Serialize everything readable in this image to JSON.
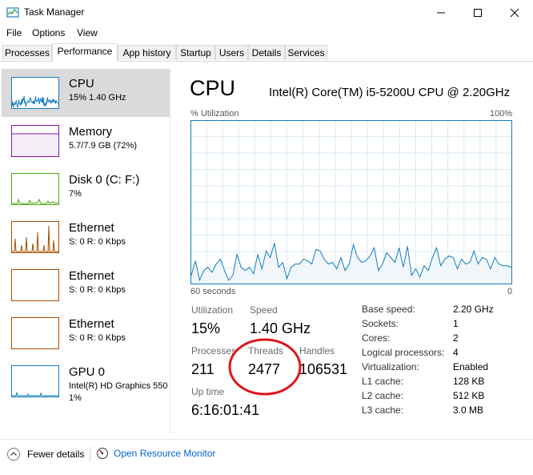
{
  "window": {
    "title": "Task Manager",
    "controls": {
      "minimize": "—",
      "maximize": "☐",
      "close": "✕"
    }
  },
  "menu": [
    "File",
    "Options",
    "View"
  ],
  "tabs": [
    {
      "label": "Processes",
      "active": false
    },
    {
      "label": "Performance",
      "active": true
    },
    {
      "label": "App history",
      "active": false
    },
    {
      "label": "Startup",
      "active": false
    },
    {
      "label": "Users",
      "active": false
    },
    {
      "label": "Details",
      "active": false
    },
    {
      "label": "Services",
      "active": false
    }
  ],
  "sidebar": [
    {
      "title": "CPU",
      "sub": "15% 1.40 GHz",
      "sub2": "",
      "color": "#117dbb",
      "selected": true
    },
    {
      "title": "Memory",
      "sub": "5.7/7.9 GB (72%)",
      "sub2": "",
      "color": "#8b12ae",
      "selected": false
    },
    {
      "title": "Disk 0 (C: F:)",
      "sub": "7%",
      "sub2": "",
      "color": "#4da60c",
      "selected": false
    },
    {
      "title": "Ethernet",
      "sub": "S: 0 R: 0 Kbps",
      "sub2": "",
      "color": "#a74f01",
      "selected": false
    },
    {
      "title": "Ethernet",
      "sub": "S: 0 R: 0 Kbps",
      "sub2": "",
      "color": "#a74f01",
      "selected": false
    },
    {
      "title": "Ethernet",
      "sub": "S: 0 R: 0 Kbps",
      "sub2": "",
      "color": "#a74f01",
      "selected": false
    },
    {
      "title": "GPU 0",
      "sub": "Intel(R) HD Graphics 550",
      "sub2": "1%",
      "color": "#117dbb",
      "selected": false
    }
  ],
  "main": {
    "title": "CPU",
    "model": "Intel(R) Core(TM) i5-5200U CPU @ 2.20GHz",
    "graph": {
      "label_top_left": "% Utilization",
      "label_top_right": "100%",
      "label_bottom_left": "60 seconds",
      "label_bottom_right": "0",
      "line_color": "#117dbb",
      "fill_color": "#f1f6fa",
      "grid_color": "#d9eaf4",
      "values": [
        5,
        14,
        2,
        8,
        10,
        7,
        12,
        15,
        8,
        2,
        5,
        18,
        10,
        8,
        10,
        6,
        18,
        9,
        20,
        16,
        25,
        10,
        13,
        3,
        10,
        12,
        12,
        15,
        14,
        12,
        21,
        20,
        15,
        12,
        13,
        9,
        16,
        8,
        12,
        24,
        16,
        13,
        14,
        17,
        22,
        8,
        12,
        19,
        16,
        13,
        22,
        10,
        23,
        5,
        9,
        4,
        11,
        8,
        16,
        22,
        11,
        15,
        17,
        16,
        9,
        15,
        12,
        13,
        20,
        12,
        16,
        15,
        9,
        16,
        12,
        11,
        11,
        10
      ]
    },
    "stats": {
      "utilization_label": "Utilization",
      "utilization": "15%",
      "speed_label": "Speed",
      "speed": "1.40 GHz",
      "processes_label": "Processes",
      "processes": "211",
      "threads_label": "Threads",
      "threads": "2477",
      "handles_label": "Handles",
      "handles": "106531",
      "uptime_label": "Up time",
      "uptime": "6:16:01:41"
    },
    "specs": [
      {
        "label": "Base speed:",
        "value": "2.20 GHz"
      },
      {
        "label": "Sockets:",
        "value": "1"
      },
      {
        "label": "Cores:",
        "value": "2"
      },
      {
        "label": "Logical processors:",
        "value": "4"
      },
      {
        "label": "Virtualization:",
        "value": "Enabled"
      },
      {
        "label": "L1 cache:",
        "value": "128 KB"
      },
      {
        "label": "L2 cache:",
        "value": "512 KB"
      },
      {
        "label": "L3 cache:",
        "value": "3.0 MB"
      }
    ],
    "annotation_color": "#e0151c"
  },
  "footer": {
    "fewer_details": "Fewer details",
    "open_resource_monitor": "Open Resource Monitor"
  }
}
